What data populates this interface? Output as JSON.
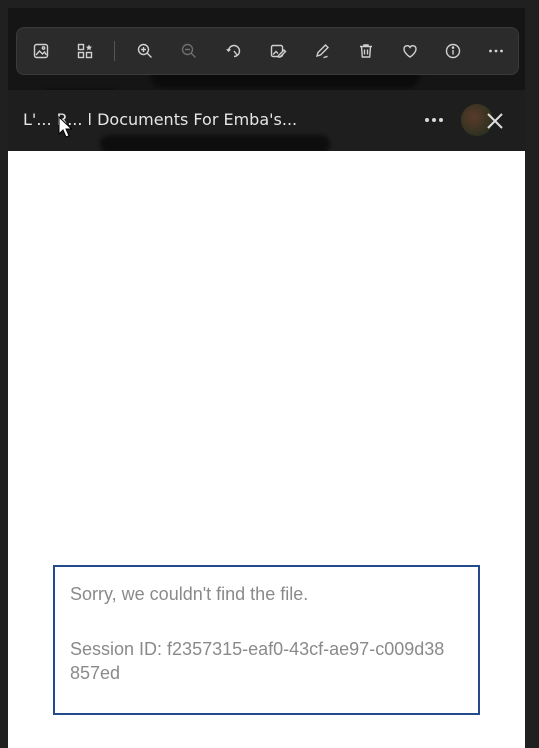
{
  "toolbar": {
    "buttons": [
      {
        "name": "image-icon"
      },
      {
        "name": "collection-icon"
      },
      {
        "name": "zoom-in-icon"
      },
      {
        "name": "zoom-out-icon"
      },
      {
        "name": "rotate-icon"
      },
      {
        "name": "edit-image-icon"
      },
      {
        "name": "draw-icon"
      },
      {
        "name": "delete-icon"
      },
      {
        "name": "favorite-icon"
      },
      {
        "name": "info-icon"
      },
      {
        "name": "more-icon"
      }
    ]
  },
  "document": {
    "title": "L'... R... l Documents For Emba's...",
    "more_label": "•••",
    "close_label": "✕"
  },
  "error": {
    "message": "Sorry, we couldn't find the file.",
    "session_id": "Session ID: f2357315-eaf0-43cf-ae97-c009d38857ed"
  },
  "colors": {
    "toolbar_bg": "#2b2b2b",
    "error_border": "#234a8a",
    "error_text": "#8a8a8a"
  }
}
